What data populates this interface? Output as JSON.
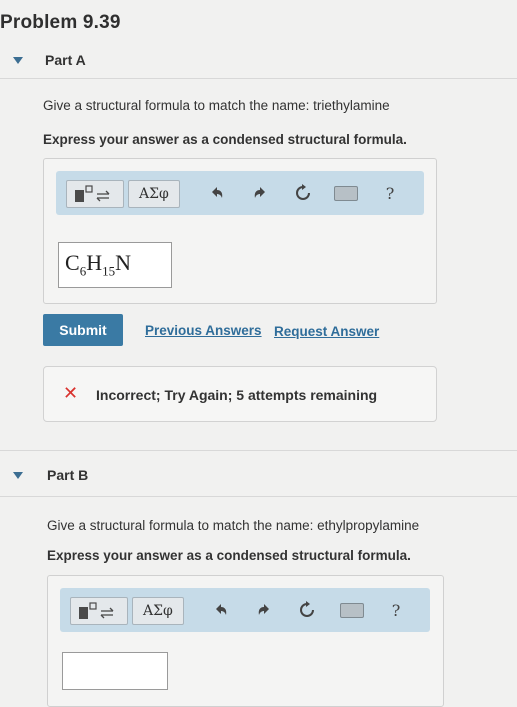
{
  "problem": {
    "title": "Problem 9.39"
  },
  "part_a": {
    "label": "Part A",
    "prompt": "Give a structural formula to match the name: triethylamine",
    "instruction": "Express your answer as a condensed structural formula.",
    "toolbar": {
      "greek_label": "ΑΣφ",
      "help_label": "?"
    },
    "answer": {
      "c": "C",
      "c_sub": "6",
      "h": "H",
      "h_sub": "15",
      "n": "N"
    },
    "submit_label": "Submit",
    "previous_answers_label": "Previous Answers",
    "request_answer_label": "Request Answer",
    "feedback": {
      "icon": "✕",
      "text": "Incorrect; Try Again; 5 attempts remaining"
    }
  },
  "part_b": {
    "label": "Part B",
    "prompt": "Give a structural formula to match the name: ethylpropylamine",
    "instruction": "Express your answer as a condensed structural formula.",
    "toolbar": {
      "greek_label": "ΑΣφ",
      "help_label": "?"
    },
    "answer": {
      "value": ""
    }
  }
}
